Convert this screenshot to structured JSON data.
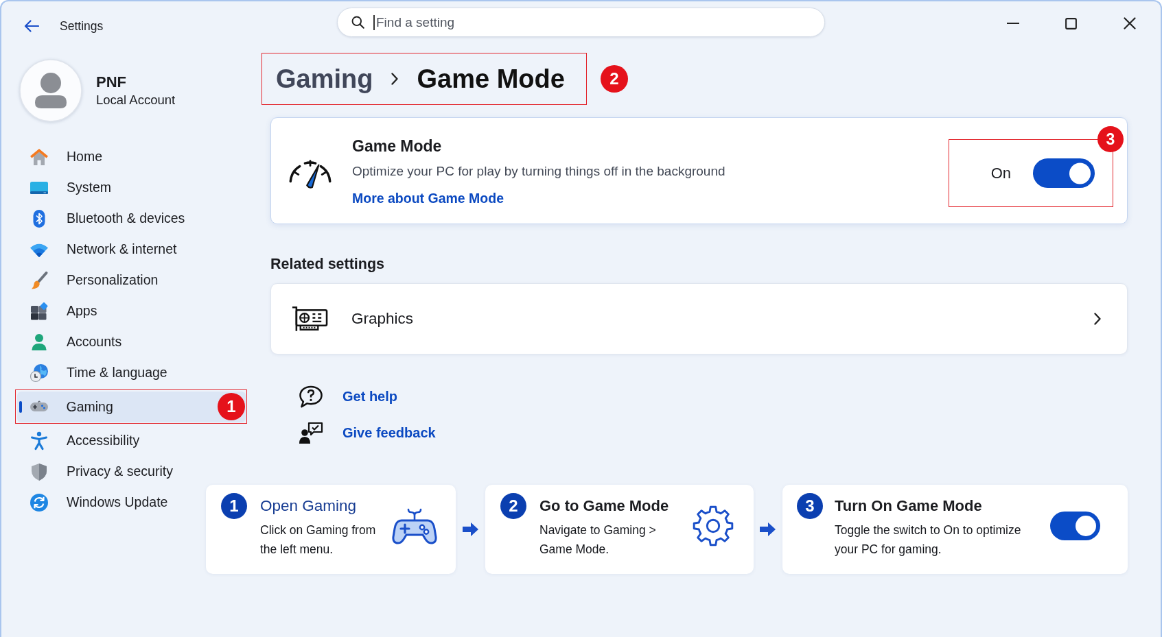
{
  "window": {
    "title": "Settings"
  },
  "search": {
    "placeholder": "Find a setting",
    "focused": true
  },
  "account": {
    "name": "PNF",
    "type": "Local Account"
  },
  "sidebar": {
    "items": [
      {
        "label": "Home",
        "selected": false
      },
      {
        "label": "System",
        "selected": false
      },
      {
        "label": "Bluetooth & devices",
        "selected": false
      },
      {
        "label": "Network & internet",
        "selected": false
      },
      {
        "label": "Personalization",
        "selected": false
      },
      {
        "label": "Apps",
        "selected": false
      },
      {
        "label": "Accounts",
        "selected": false
      },
      {
        "label": "Time & language",
        "selected": false
      },
      {
        "label": "Gaming",
        "selected": true,
        "annotation": "1"
      },
      {
        "label": "Accessibility",
        "selected": false
      },
      {
        "label": "Privacy & security",
        "selected": false
      },
      {
        "label": "Windows Update",
        "selected": false
      }
    ]
  },
  "breadcrumb": {
    "items": [
      {
        "label": "Gaming",
        "current": false
      },
      {
        "label": "Game Mode",
        "current": true
      }
    ],
    "annotation": "2"
  },
  "game_mode": {
    "title": "Game Mode",
    "description": "Optimize your PC for play by turning things off in the background",
    "link": "More about Game Mode",
    "toggle": {
      "label": "On",
      "on": true,
      "annotation": "3"
    }
  },
  "related_settings": {
    "heading": "Related settings",
    "items": [
      {
        "label": "Graphics"
      }
    ]
  },
  "help_links": [
    {
      "label": "Get help"
    },
    {
      "label": "Give feedback"
    }
  ],
  "steps": [
    {
      "number": "1",
      "title": "Open Gaming",
      "description": [
        "Click on Gaming from",
        "the left menu."
      ],
      "active": true
    },
    {
      "number": "2",
      "title": "Go to Game Mode",
      "description": [
        "Navigate to Gaming >",
        "Game Mode."
      ],
      "active": false
    },
    {
      "number": "3",
      "title": "Turn On Game Mode",
      "description": [
        "Toggle the switch to On to optimize",
        "your PC for gaming."
      ],
      "active": false
    }
  ]
}
